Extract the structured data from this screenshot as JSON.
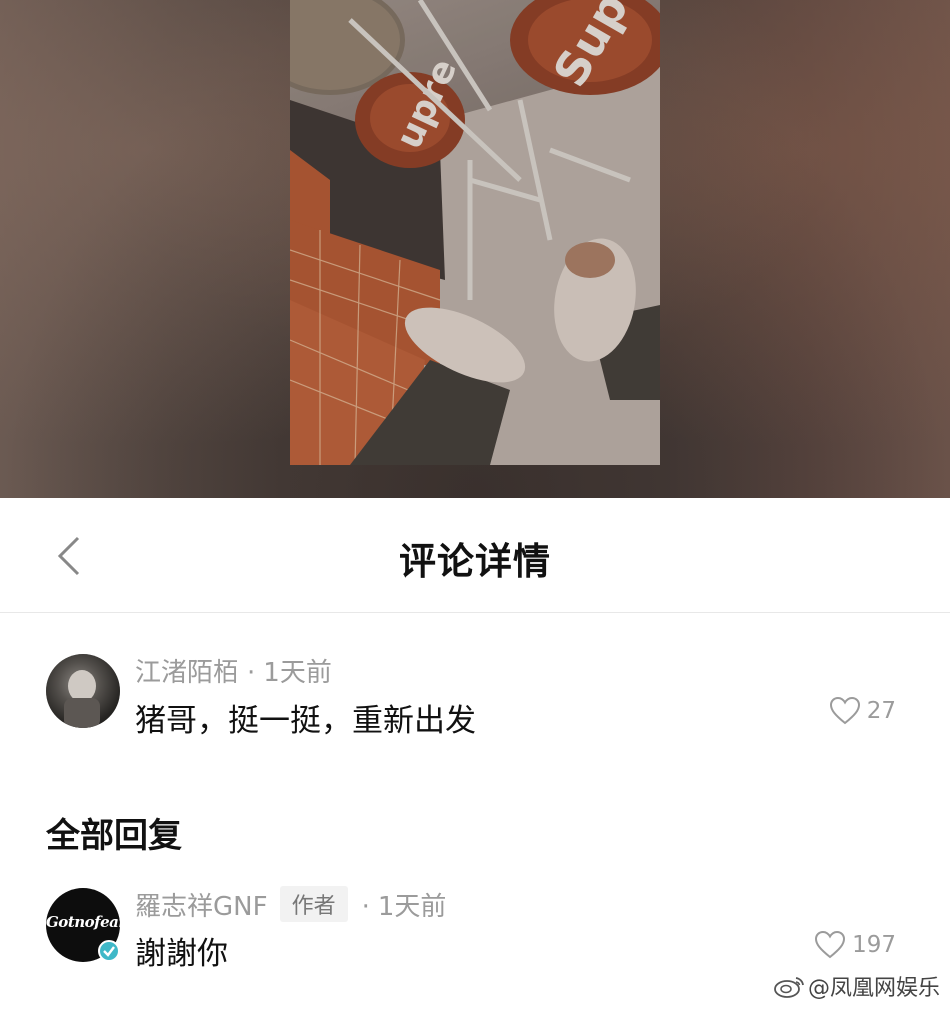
{
  "header": {
    "title": "评论详情",
    "back_icon": "chevron-left-icon"
  },
  "comment": {
    "author": "江渚陌栢",
    "separator": "·",
    "time": "1天前",
    "text": "猪哥，挺一挺，重新出发",
    "like_count": "27",
    "like_icon": "heart-outline-icon"
  },
  "replies_section": {
    "title": "全部回复"
  },
  "reply": {
    "author": "羅志祥GNF",
    "author_tag": "作者",
    "separator": "·",
    "time": "1天前",
    "text": "謝謝你",
    "like_count": "197",
    "avatar_text": "Gotnofears",
    "badge_icon": "verified-check-icon"
  },
  "watermark": {
    "text": "@凤凰网娱乐",
    "icon": "weibo-icon"
  },
  "colors": {
    "meta_gray": "#9b9b9b",
    "verified": "#3fb8c8"
  }
}
